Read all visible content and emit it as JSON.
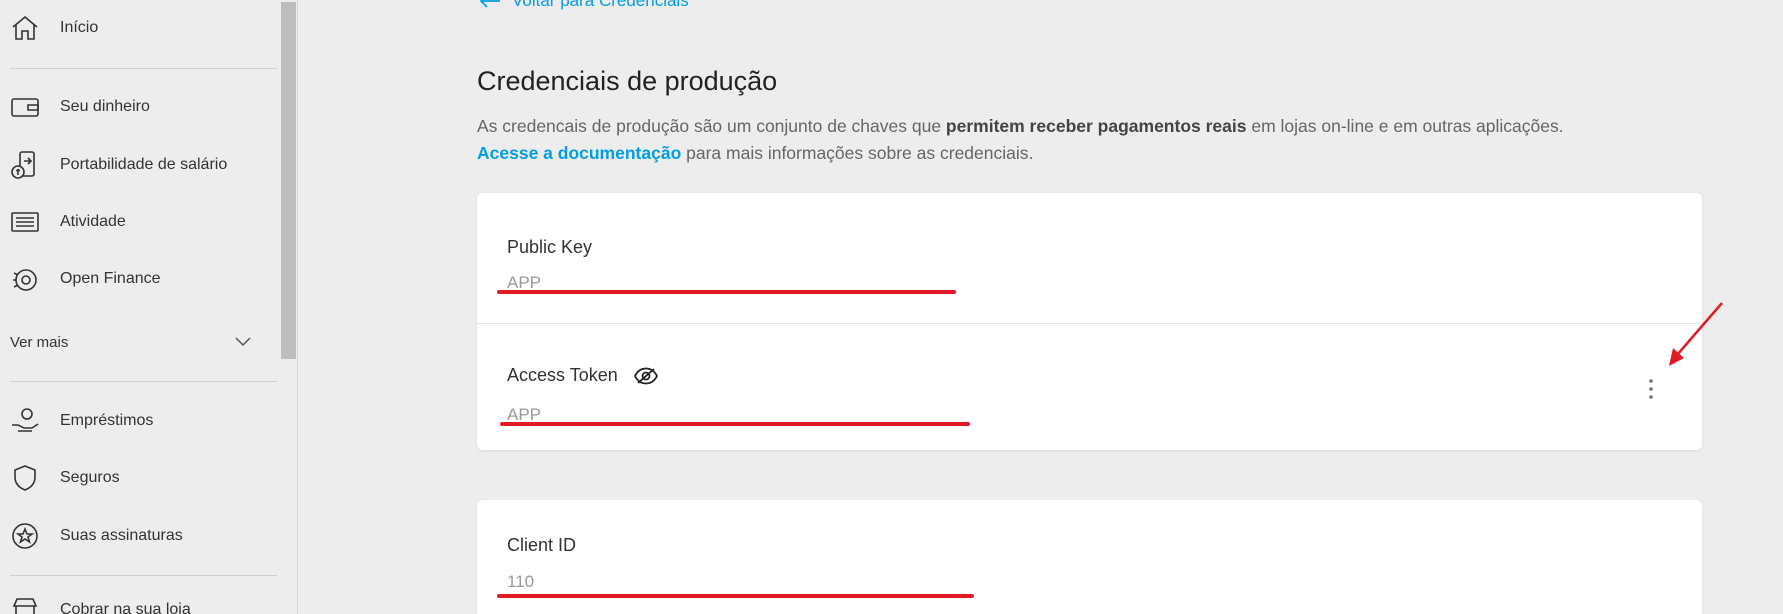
{
  "sidebar": {
    "items": [
      {
        "label": "Início",
        "icon": "home-icon"
      },
      {
        "label": "Seu dinheiro",
        "icon": "wallet-icon"
      },
      {
        "label": "Portabilidade de salário",
        "icon": "salary-portability-icon"
      },
      {
        "label": "Atividade",
        "icon": "activity-list-icon"
      },
      {
        "label": "Open Finance",
        "icon": "open-finance-icon"
      },
      {
        "label": "Empréstimos",
        "icon": "loan-hand-icon"
      },
      {
        "label": "Seguros",
        "icon": "shield-icon"
      },
      {
        "label": "Suas assinaturas",
        "icon": "star-badge-icon"
      },
      {
        "label": "Cobrar na sua loja",
        "icon": "store-icon"
      }
    ],
    "ver_mais": "Ver mais"
  },
  "main": {
    "back_link": "Voltar para Credenciais",
    "title": "Credenciais de produção",
    "desc_part1": "As credencais de produção são um conjunto de chaves que ",
    "desc_bold": "permitem receber pagamentos reais",
    "desc_part2": " em lojas on-line e em outras aplicações.",
    "doc_link": "Acesse a documentação",
    "desc_part3": " para mais informações sobre as credenciais."
  },
  "credentials": {
    "public_key": {
      "label": "Public Key",
      "value": "APP_"
    },
    "access_token": {
      "label": "Access Token",
      "value": "APP"
    },
    "client_id": {
      "label": "Client ID",
      "value": "110"
    }
  },
  "colors": {
    "accent": "#009ee3",
    "annotation": "#e01b24"
  }
}
